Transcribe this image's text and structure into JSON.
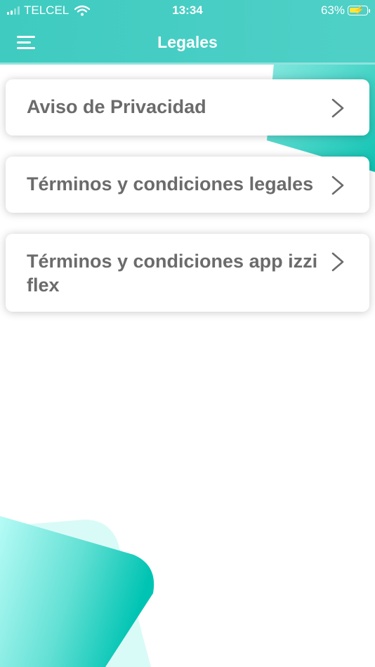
{
  "status_bar": {
    "carrier": "TELCEL",
    "time": "13:34",
    "battery_percent": "63%",
    "battery_level": 0.63,
    "wifi_icon": "wifi-icon",
    "signal_icon": "signal-icon",
    "charging_icon": "charging-bolt-icon"
  },
  "header": {
    "title": "Legales",
    "menu_icon": "hamburger-menu-icon"
  },
  "items": [
    {
      "label": "Aviso de Privacidad",
      "icon": "chevron-right-icon"
    },
    {
      "label": "Términos y condiciones legales",
      "icon": "chevron-right-icon"
    },
    {
      "label": "Términos y condiciones app izzi flex",
      "icon": "chevron-right-icon"
    }
  ],
  "colors": {
    "header_bg": "#44ccc2",
    "card_text": "#6b6b6b",
    "accent_teal": "#00c4b3",
    "light_teal": "#b8fbf5"
  }
}
